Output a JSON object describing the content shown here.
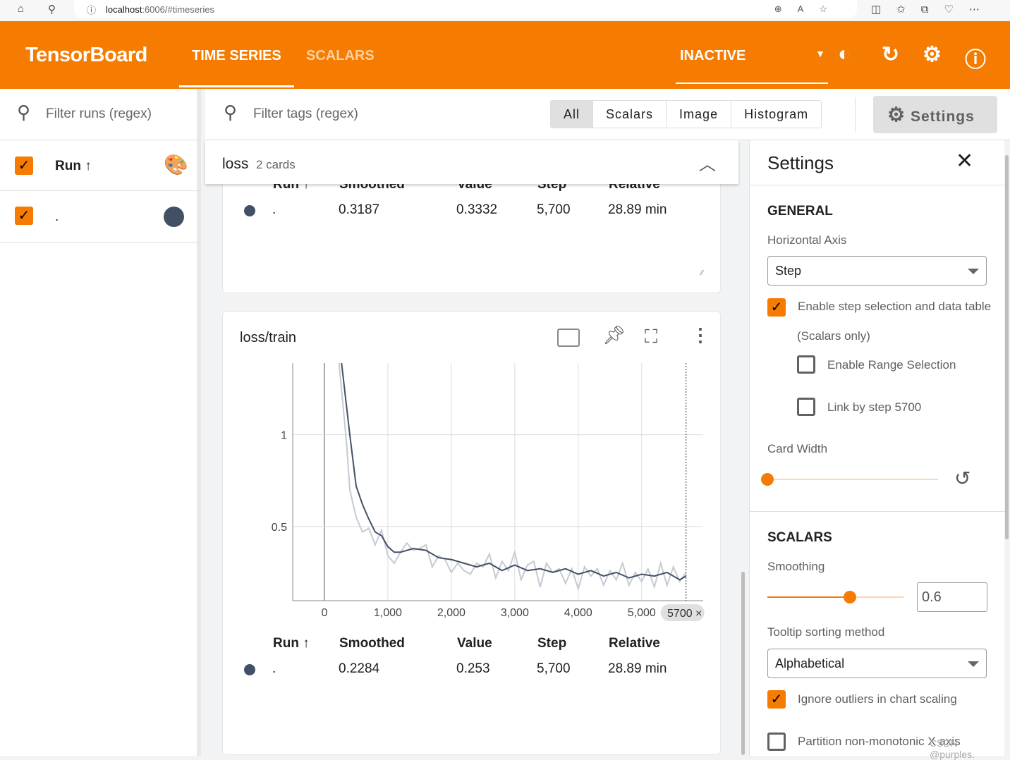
{
  "browser": {
    "url_host": "localhost",
    "url_rest": ":6006/#timeseries"
  },
  "header": {
    "brand": "TensorBoard",
    "tabs": [
      "TIME SERIES",
      "SCALARS"
    ],
    "run_state": "INACTIVE",
    "accent": "#f57c00"
  },
  "runs": {
    "filter_placeholder": "Filter runs (regex)",
    "header": "Run ↑",
    "items": [
      {
        "name": ".",
        "color": "#425066",
        "checked": true
      }
    ]
  },
  "tags": {
    "filter_placeholder": "Filter tags (regex)",
    "types": [
      "All",
      "Scalars",
      "Image",
      "Histogram"
    ],
    "settings_button": "Settings"
  },
  "group": {
    "name": "loss",
    "count": "2 cards"
  },
  "table_headers": [
    "Run ↑",
    "Smoothed",
    "Value",
    "Step",
    "Relative"
  ],
  "card1": {
    "row": [
      ".",
      "0.3187",
      "0.3332",
      "5,700",
      "28.89 min"
    ]
  },
  "card2": {
    "title": "loss/train",
    "row": [
      ".",
      "0.2284",
      "0.253",
      "5,700",
      "28.89 min"
    ]
  },
  "chart_data": {
    "type": "line",
    "title": "loss/train",
    "xlim": [
      -500,
      5970
    ],
    "ylim": [
      0.096,
      1.39
    ],
    "x_ticks": [
      "0",
      "1,000",
      "2,000",
      "3,000",
      "4,000",
      "5,000"
    ],
    "y_ticks": [
      "0.5",
      "1"
    ],
    "selected_step": "5700",
    "grid": true,
    "series": [
      {
        "role": "raw",
        "color": "#c5cad3",
        "x": [
          230,
          350,
          400,
          500,
          600,
          700,
          800,
          900,
          1000,
          1100,
          1200,
          1300,
          1400,
          1500,
          1600,
          1700,
          1800,
          1900,
          2000,
          2100,
          2200,
          2300,
          2400,
          2500,
          2600,
          2700,
          2800,
          2900,
          3000,
          3100,
          3200,
          3300,
          3400,
          3500,
          3600,
          3700,
          3800,
          3900,
          4000,
          4100,
          4200,
          4300,
          4400,
          4500,
          4600,
          4700,
          4800,
          4900,
          5000,
          5100,
          5200,
          5300,
          5400,
          5500,
          5600,
          5700
        ],
        "y": [
          1.39,
          0.95,
          0.7,
          0.55,
          0.47,
          0.49,
          0.4,
          0.48,
          0.34,
          0.3,
          0.36,
          0.41,
          0.37,
          0.38,
          0.4,
          0.28,
          0.34,
          0.32,
          0.25,
          0.3,
          0.26,
          0.24,
          0.3,
          0.28,
          0.35,
          0.22,
          0.31,
          0.26,
          0.36,
          0.21,
          0.29,
          0.31,
          0.17,
          0.3,
          0.25,
          0.27,
          0.19,
          0.27,
          0.16,
          0.28,
          0.23,
          0.27,
          0.18,
          0.26,
          0.21,
          0.3,
          0.18,
          0.25,
          0.2,
          0.27,
          0.17,
          0.3,
          0.18,
          0.28,
          0.2,
          0.25
        ]
      },
      {
        "role": "smoothed",
        "color": "#425066",
        "x": [
          270,
          400,
          500,
          600,
          700,
          800,
          900,
          1000,
          1100,
          1200,
          1400,
          1600,
          1800,
          2000,
          2200,
          2400,
          2600,
          2800,
          3000,
          3200,
          3400,
          3600,
          3800,
          4000,
          4200,
          4400,
          4600,
          4800,
          5000,
          5200,
          5400,
          5600,
          5700
        ],
        "y": [
          1.39,
          1.0,
          0.72,
          0.62,
          0.54,
          0.47,
          0.45,
          0.39,
          0.36,
          0.36,
          0.38,
          0.37,
          0.33,
          0.32,
          0.3,
          0.28,
          0.3,
          0.26,
          0.29,
          0.26,
          0.27,
          0.25,
          0.27,
          0.24,
          0.26,
          0.23,
          0.25,
          0.22,
          0.24,
          0.23,
          0.25,
          0.21,
          0.23
        ]
      }
    ]
  },
  "settings": {
    "title": "Settings",
    "general": "GENERAL",
    "horizontal_axis_label": "Horizontal Axis",
    "horizontal_axis": "Step",
    "step_selection": "Enable step selection and data table",
    "scalars_only": "(Scalars only)",
    "range_selection": "Enable Range Selection",
    "link_by_step": "Link by step 5700",
    "card_width": "Card Width",
    "card_width_value": 0,
    "scalars": "SCALARS",
    "smoothing": "Smoothing",
    "smoothing_value": "0.6",
    "tooltip_label": "Tooltip sorting method",
    "tooltip": "Alphabetical",
    "ignore_outliers": "Ignore outliers in chart scaling",
    "partition": "Partition non-monotonic X axis"
  },
  "watermark": "CSDN @purples."
}
